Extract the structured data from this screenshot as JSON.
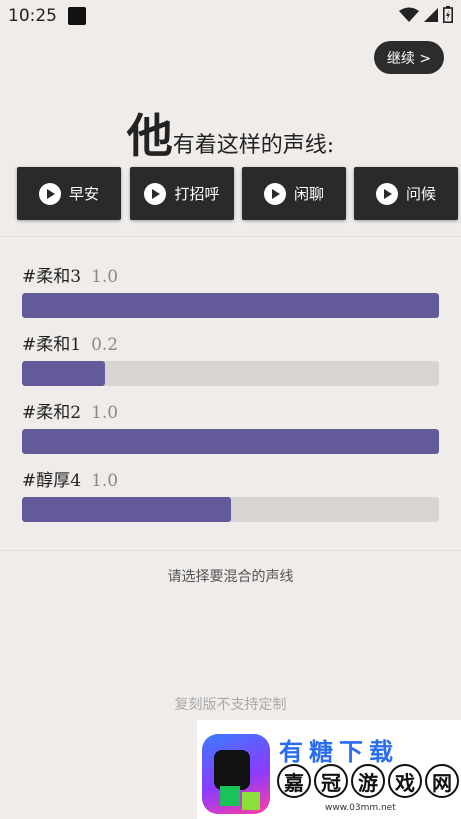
{
  "status_bar": {
    "time": "10:25"
  },
  "header": {
    "continue_label": "继续 >"
  },
  "headline": {
    "big": "他",
    "rest": "有着这样的声线:"
  },
  "voice_buttons": [
    {
      "label": "早安"
    },
    {
      "label": "打招呼"
    },
    {
      "label": "闲聊"
    },
    {
      "label": "问候"
    }
  ],
  "mixes": [
    {
      "name": "#柔和3",
      "value": "1.0",
      "fill": 1.0
    },
    {
      "name": "#柔和1",
      "value": "0.2",
      "fill": 0.2
    },
    {
      "name": "#柔和2",
      "value": "1.0",
      "fill": 1.0
    },
    {
      "name": "#醇厚4",
      "value": "1.0",
      "fill": 0.5
    }
  ],
  "hint": "请选择要混合的声线",
  "notice": "复刻版不支持定制",
  "watermark": {
    "top_text": "有糖下载",
    "chars": [
      "嘉",
      "冠",
      "游",
      "戏",
      "网"
    ],
    "url": "www.03mm.net"
  },
  "colors": {
    "accent": "#635a99",
    "track": "#d8d4d2",
    "button_bg": "#2a2a2a",
    "background": "#efecea"
  }
}
